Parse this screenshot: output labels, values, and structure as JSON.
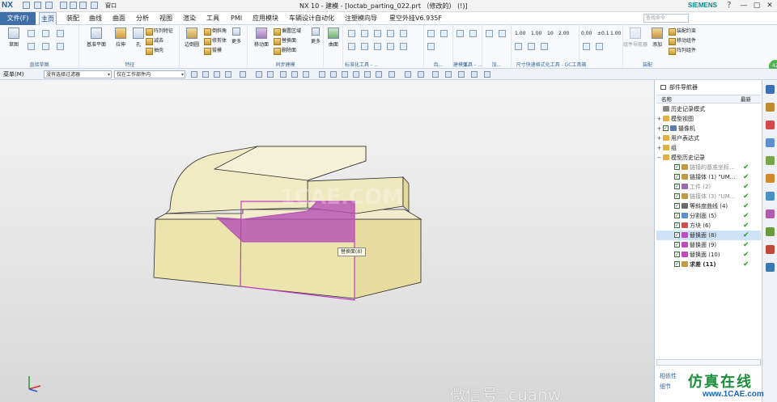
{
  "app": {
    "logo": "NX",
    "title": "NX 10 - 建模 - [loctab_parting_022.prt （修改的） (!)]",
    "brand": "SIEMENS",
    "window_buttons": [
      "？",
      "—",
      "▢",
      "✕"
    ],
    "window_menu": "窗口"
  },
  "tabs": {
    "file": "文件(F)",
    "items": [
      "主页",
      "装配",
      "曲线",
      "曲面",
      "分析",
      "视图",
      "渲染",
      "工具",
      "PMI",
      "应用模块",
      "车辆设计自动化",
      "注塑模向导",
      "星空外挂V6.935F"
    ],
    "active": "主页",
    "search_placeholder": "查找命令"
  },
  "ribbon": {
    "sketch": "草图",
    "direct_sketch_label": "直接草图",
    "datum_plane": "基准平面",
    "extrude": "拉伸",
    "hole": "孔",
    "pattern_feature": "阵列特征",
    "combine": "减去",
    "shell": "抽壳",
    "feature_label": "特征",
    "edge_blend": "边倒圆",
    "chamfer": "倒斜角",
    "trim_body": "修剪体",
    "draft": "拔模",
    "more1": "更多",
    "move_face": "移动面",
    "offset_region": "偏置区域",
    "replace_face": "替换面",
    "delete_face": "删除面",
    "sync_label": "同步建模",
    "more2": "更多",
    "surface": "曲面",
    "standard_tools_label": "标准化工具 - ...",
    "dots_label1": "齿...",
    "dots_label2": "弹...",
    "dots_label3": "加...",
    "building_tools_label": "建模工具 - ...",
    "dims_label": "尺寸快速格式化工具 - GC工具箱",
    "assembly_nav": "组件导航器",
    "add": "添加",
    "assembly_constraint": "装配约束",
    "move_component": "移动组件",
    "pattern_component": "阵列组件",
    "assembly_label": "装配",
    "dims_small": [
      "1.00",
      "1.00",
      "10",
      "2.00",
      "0.00",
      "±0.1",
      "1.00",
      "0.1"
    ]
  },
  "selection_bar": {
    "menu": "菜单(M)",
    "filter": "没有选择过滤器",
    "scope": "仅在工作部件内"
  },
  "viewport": {
    "tooltip": "替换面(8)",
    "watermark_cae": "1CAE.COM",
    "wechat": "微信号: cuanw",
    "footer_brand": "仿真在线",
    "footer_site": "www.1CAE.com"
  },
  "navigator": {
    "title": "部件导航器",
    "col_name": "名称",
    "col_latest": "最新",
    "rows": [
      {
        "label": "历史记录模式",
        "expand": "",
        "check": false,
        "icon": "clock-icon",
        "dim": false,
        "ok": false
      },
      {
        "label": "模型视图",
        "expand": "+",
        "check": false,
        "icon": "folder-icon",
        "dim": false,
        "ok": false
      },
      {
        "label": "摄像机",
        "expand": "+",
        "check": true,
        "icon": "camera-icon",
        "dim": false,
        "ok": false
      },
      {
        "label": "用户表达式",
        "expand": "+",
        "check": false,
        "icon": "folder-icon",
        "dim": false,
        "ok": false
      },
      {
        "label": "组",
        "expand": "+",
        "check": false,
        "icon": "folder-icon",
        "dim": false,
        "ok": false
      },
      {
        "label": "模型历史记录",
        "expand": "−",
        "check": false,
        "icon": "folder-icon",
        "dim": false,
        "ok": false
      },
      {
        "label": "链接的基准坐标...",
        "expand": "",
        "check": true,
        "icon": "datum-icon",
        "dim": true,
        "ok": true
      },
      {
        "label": "链接体 (1) \"UM...",
        "expand": "",
        "check": true,
        "icon": "link-icon",
        "dim": false,
        "ok": true
      },
      {
        "label": "工件 (2)",
        "expand": "",
        "check": true,
        "icon": "workpiece-icon",
        "dim": true,
        "ok": true
      },
      {
        "label": "链接体 (3) \"UM...",
        "expand": "",
        "check": true,
        "icon": "link-icon",
        "dim": true,
        "ok": true
      },
      {
        "label": "等斜度曲线 (4)",
        "expand": "",
        "check": true,
        "icon": "curve-icon",
        "dim": false,
        "ok": true
      },
      {
        "label": "分割面 (5)",
        "expand": "",
        "check": true,
        "icon": "divide-face-icon",
        "dim": false,
        "ok": true
      },
      {
        "label": "方块 (6)",
        "expand": "",
        "check": true,
        "icon": "block-icon",
        "dim": false,
        "ok": true
      },
      {
        "label": "替换面 (8)",
        "expand": "",
        "check": true,
        "icon": "replace-face-icon",
        "dim": false,
        "ok": true,
        "selected": true
      },
      {
        "label": "替换面 (9)",
        "expand": "",
        "check": true,
        "icon": "replace-face-icon",
        "dim": false,
        "ok": true
      },
      {
        "label": "替换面 (10)",
        "expand": "",
        "check": true,
        "icon": "replace-face-icon",
        "dim": false,
        "ok": true
      },
      {
        "label": "求差 (11)",
        "expand": "",
        "check": true,
        "icon": "subtract-icon",
        "dim": false,
        "ok": true,
        "bold": true
      }
    ],
    "footer1": "相依性",
    "footer2": "细节"
  },
  "colors": {
    "ribbon_accent": "#3f6ea8",
    "part_face": "#f0eabb",
    "part_edge": "#2b2b2b",
    "highlight_face": "#b44fb4",
    "selection_blue": "#cfe3f8",
    "ok_green": "#23a023"
  }
}
